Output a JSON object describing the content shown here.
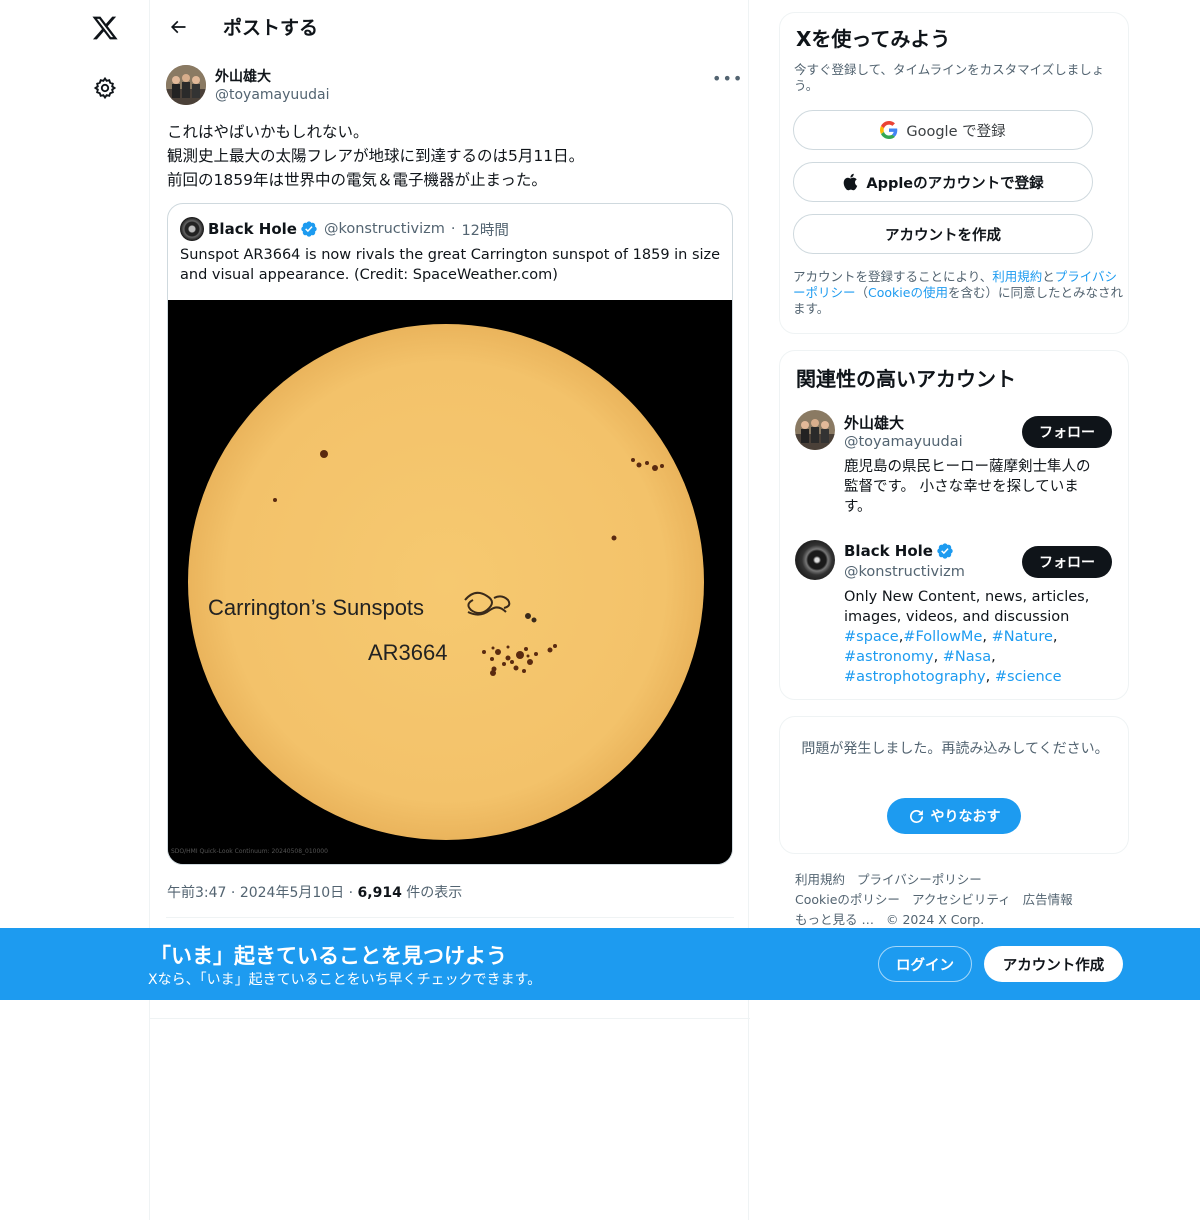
{
  "header": {
    "title": "ポストする"
  },
  "post": {
    "author_name": "外山雄大",
    "author_handle": "@toyamayuudai",
    "text_lines": [
      "これはやばいかもしれない。",
      "観測史上最大の太陽フレアが地球に到達するのは5月11日。",
      "前回の1859年は世界中の電気＆電子機器が止まった。"
    ],
    "quote": {
      "name": "Black Hole",
      "handle": "@konstructivizm",
      "time": "12時間",
      "text": "Sunspot AR3664 is now rivals the great Carrington sunspot of 1859 in size and visual appearance. (Credit: SpaceWeather.com)",
      "image_label_1": "Carrington’s Sunspots",
      "image_label_2": "AR3664",
      "image_credit": "SDO/HMI Quick-Look Continuum: 20240508_010000"
    },
    "time": "午前3:47",
    "date": "2024年5月10日",
    "views_count": "6,914",
    "views_label": "件の表示"
  },
  "signup_card": {
    "title": "Xを使ってみよう",
    "subtitle": "今すぐ登録して、タイムラインをカスタマイズしましょう。",
    "google_label": "Google で登録",
    "apple_label": "Appleのアカウントで登録",
    "create_label": "アカウントを作成",
    "legal_prefix": "アカウントを登録することにより、",
    "legal_terms": "利用規約",
    "legal_and": "と",
    "legal_privacy": "プライバシーポリシー",
    "legal_open": "（",
    "legal_cookie": "Cookieの使用",
    "legal_suffix": "を含む）に同意したとみなされます。"
  },
  "relevant": {
    "title": "関連性の高いアカウント",
    "follow_label": "フォロー",
    "accounts": [
      {
        "name": "外山雄大",
        "handle": "@toyamayuudai",
        "bio": "鹿児島の県民ヒーロー薩摩剣士隼人の監督です。 小さな幸せを探しています。"
      },
      {
        "name": "Black Hole",
        "handle": "@konstructivizm",
        "bio_text": "Only New Content, news, articles, images, videos, and discussion",
        "tags": [
          "#space",
          "#FollowMe",
          "#Nature",
          "#astronomy",
          "#Nasa",
          "#astrophotography",
          "#science"
        ]
      }
    ]
  },
  "error_card": {
    "message": "問題が発生しました。再読み込みしてください。",
    "retry_label": "やりなおす"
  },
  "footer": {
    "links": [
      "利用規約",
      "プライバシーポリシー",
      "Cookieのポリシー",
      "アクセシビリティ",
      "広告情報",
      "もっと見る …"
    ],
    "copyright": "© 2024 X Corp."
  },
  "banner": {
    "title": "「いま」起きていることを見つけよう",
    "subtitle": "Xなら、「いま」起きていることをいち早くチェックできます。",
    "login_label": "ログイン",
    "signup_label": "アカウント作成"
  },
  "colors": {
    "accent": "#1d9bf0",
    "text": "#0f1419",
    "secondary": "#536471",
    "sun": "#f4c66c"
  }
}
